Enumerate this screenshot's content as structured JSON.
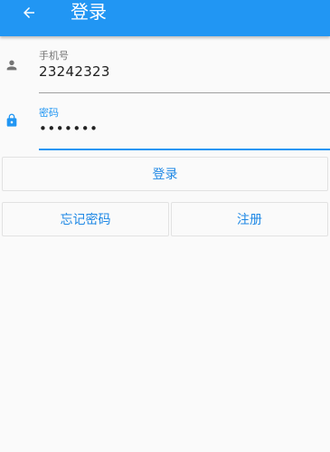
{
  "appbar": {
    "title": "登录",
    "back_icon": "arrow-left-icon",
    "color": "#2196f3"
  },
  "form": {
    "phone": {
      "label": "手机号",
      "value": "23242323",
      "icon": "person-icon"
    },
    "password": {
      "label": "密码",
      "value": "•••••••",
      "icon": "lock-icon",
      "focused": true
    }
  },
  "buttons": {
    "login_label": "登录",
    "forgot_label": "忘记密码",
    "register_label": "注册"
  },
  "colors": {
    "accent": "#2196f3",
    "background": "#fafafa"
  }
}
